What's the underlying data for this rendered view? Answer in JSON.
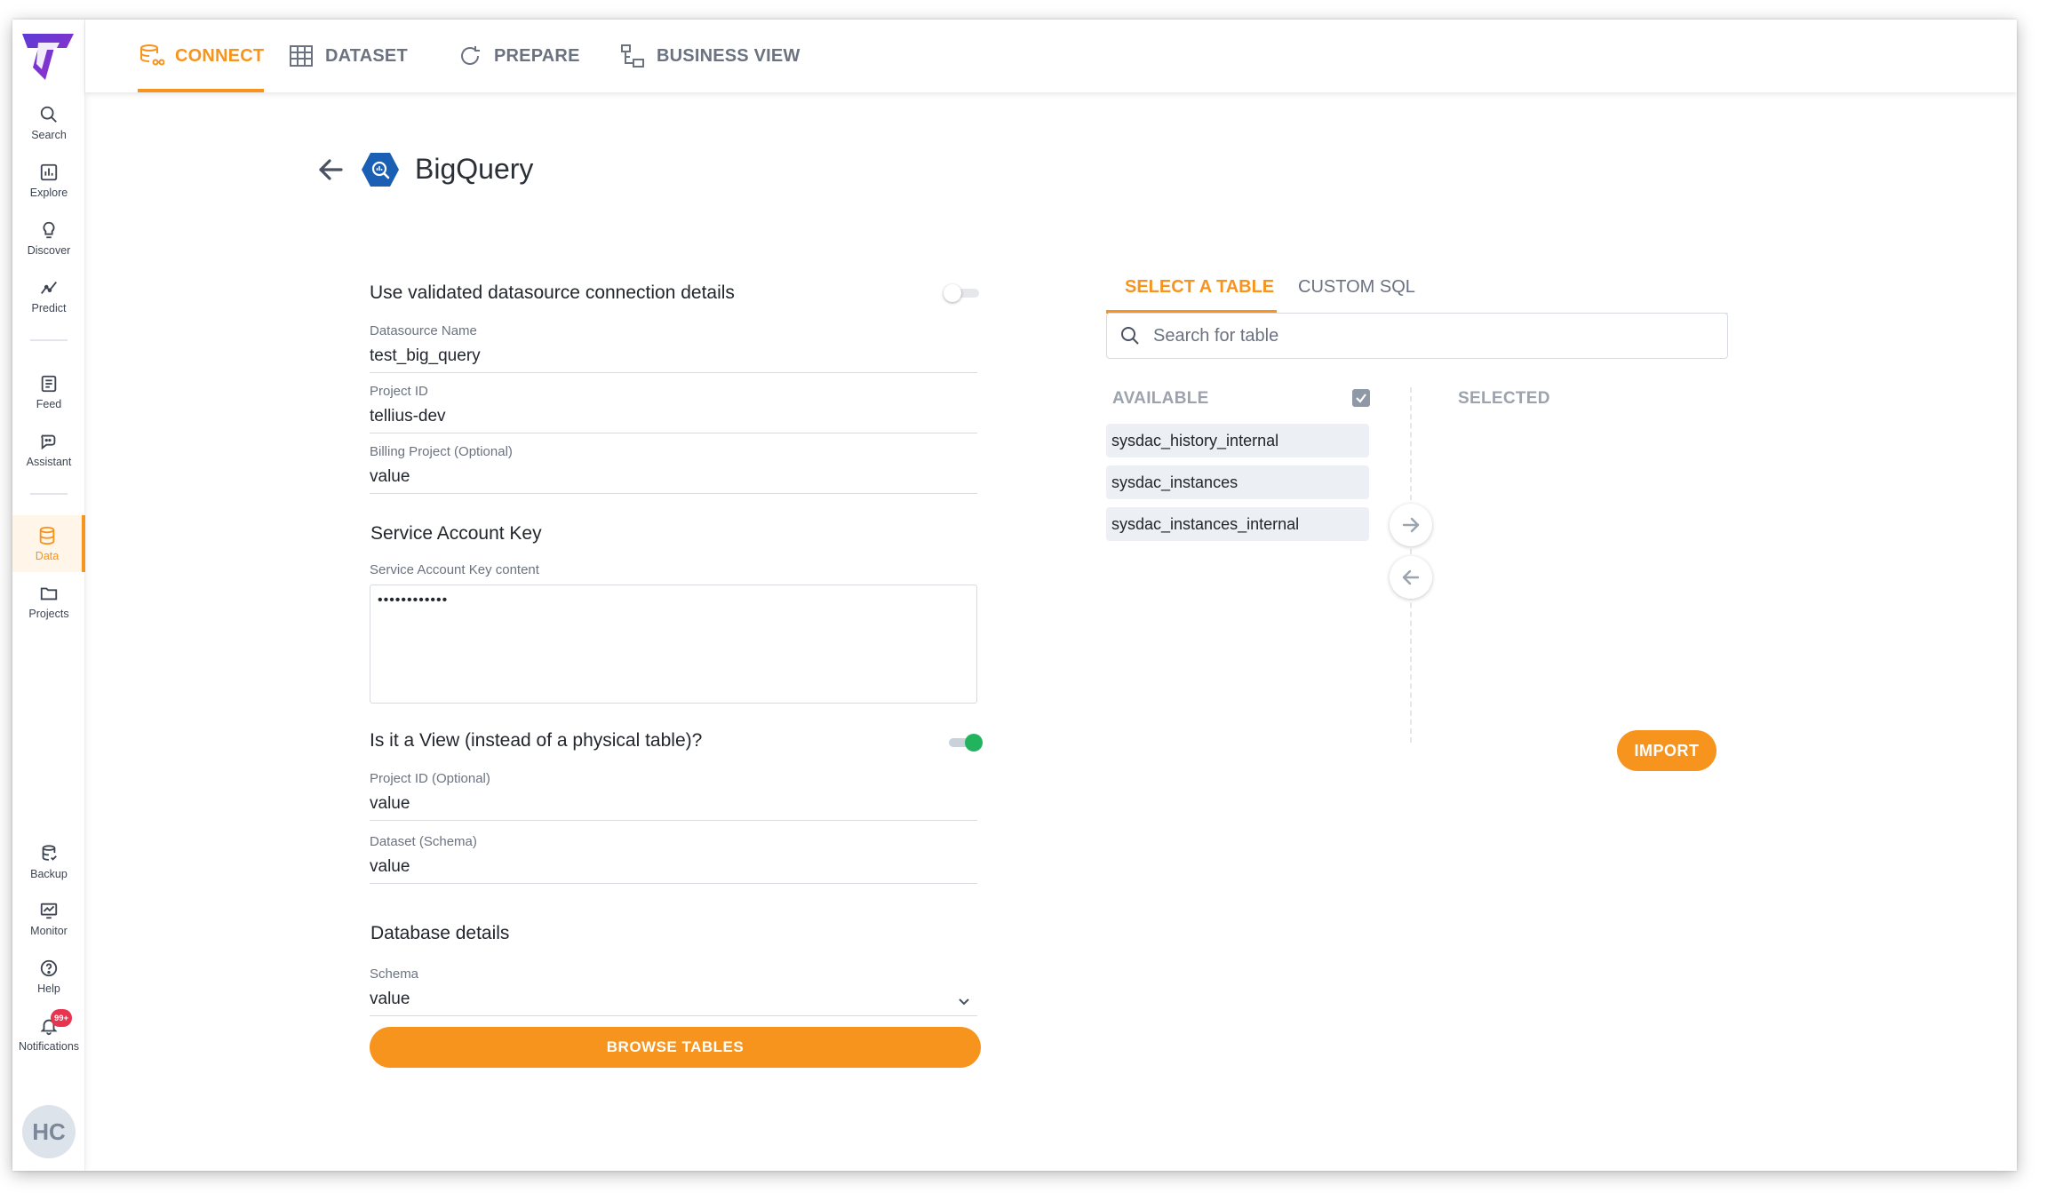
{
  "sidebar": {
    "items": [
      {
        "label": "Search",
        "icon": "search-icon"
      },
      {
        "label": "Explore",
        "icon": "explore-icon"
      },
      {
        "label": "Discover",
        "icon": "discover-icon"
      },
      {
        "label": "Predict",
        "icon": "predict-icon"
      },
      {
        "label": "Feed",
        "icon": "feed-icon"
      },
      {
        "label": "Assistant",
        "icon": "assistant-icon"
      },
      {
        "label": "Data",
        "icon": "database-icon",
        "active": true
      },
      {
        "label": "Projects",
        "icon": "folder-icon"
      },
      {
        "label": "Backup",
        "icon": "backup-icon"
      },
      {
        "label": "Monitor",
        "icon": "monitor-icon"
      },
      {
        "label": "Help",
        "icon": "help-icon"
      },
      {
        "label": "Notifications",
        "icon": "bell-icon"
      }
    ],
    "notification_badge": "99+",
    "avatar_initials": "HC"
  },
  "topnav": {
    "tabs": [
      {
        "label": "CONNECT",
        "icon": "connect-icon",
        "active": true
      },
      {
        "label": "DATASET",
        "icon": "dataset-icon"
      },
      {
        "label": "PREPARE",
        "icon": "prepare-icon"
      },
      {
        "label": "BUSINESS VIEW",
        "icon": "business-view-icon"
      }
    ]
  },
  "header": {
    "title": "BigQuery"
  },
  "form": {
    "validated_label": "Use validated datasource connection details",
    "validated_toggle": false,
    "datasource_name": {
      "label": "Datasource Name",
      "value": "test_big_query"
    },
    "project_id": {
      "label": "Project ID",
      "value": "tellius-dev"
    },
    "billing_project": {
      "label": "Billing Project (Optional)",
      "value": "value"
    },
    "service_account_title": "Service Account Key",
    "service_account_key": {
      "label": "Service Account Key content",
      "value": "••••••••••••"
    },
    "view_label": "Is it a View (instead of a physical table)?",
    "view_toggle": true,
    "view_project_id": {
      "label": "Project ID (Optional)",
      "value": "value"
    },
    "dataset_schema": {
      "label": "Dataset (Schema)",
      "value": "value"
    },
    "database_details_title": "Database details",
    "schema": {
      "label": "Schema",
      "value": "value"
    },
    "browse_button": "BROWSE TABLES"
  },
  "table_picker": {
    "tabs": [
      {
        "label": "SELECT A TABLE",
        "active": true
      },
      {
        "label": "CUSTOM SQL"
      }
    ],
    "search_placeholder": "Search for table",
    "available_label": "AVAILABLE",
    "selected_label": "SELECTED",
    "available_tables": [
      "sysdac_history_internal",
      "sysdac_instances",
      "sysdac_instances_internal"
    ],
    "import_button": "IMPORT"
  },
  "colors": {
    "accent": "#f7941d",
    "toggle_on": "#22b35e",
    "badge": "#e8344e",
    "bigquery_blue": "#1a5fb4"
  }
}
